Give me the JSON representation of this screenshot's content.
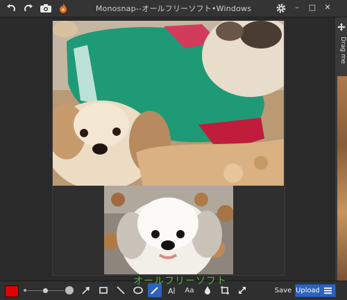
{
  "window": {
    "title": "Monosnap--オールフリーソフト•Windows",
    "controls": {
      "minimize": "–",
      "maximize": "□",
      "close": "✕"
    }
  },
  "titlebar_icons": [
    "undo-icon",
    "redo-icon",
    "camera-icon",
    "flame-logo-icon",
    "gear-icon"
  ],
  "side_panel": {
    "label": "Drag me"
  },
  "toolbar": {
    "tools": [
      "color-swatch",
      "line-width-slider",
      "arrow-icon",
      "rectangle-icon",
      "line-icon",
      "ellipse-icon",
      "pen-icon",
      "text-icon",
      "text-style-icon",
      "blur-drop-icon",
      "crop-icon",
      "resize-icon"
    ],
    "save_label": "Save",
    "upload_label": "Upload",
    "text_tool_label": "Aa",
    "color": "#e00000"
  },
  "watermark": {
    "text": "オールフリーソフト"
  },
  "colors": {
    "upload_button": "#2d63bd",
    "accent_blue": "#2d63bd",
    "brush_red": "#e00000",
    "watermark_green": "#52b048"
  }
}
